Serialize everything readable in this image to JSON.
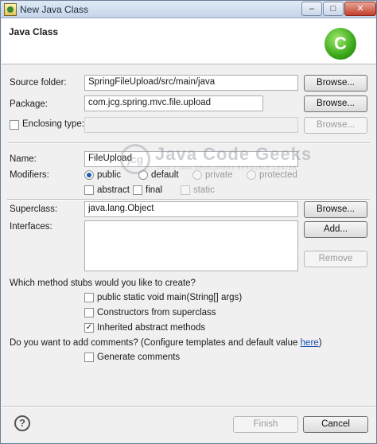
{
  "window": {
    "title": "New Java Class",
    "minimize": "–",
    "maximize": "□",
    "close": "✕"
  },
  "banner": {
    "title": "Java Class",
    "logo_letter": "C"
  },
  "form": {
    "source_folder": {
      "label": "Source folder:",
      "value": "SpringFileUpload/src/main/java",
      "browse": "Browse..."
    },
    "package": {
      "label": "Package:",
      "value": "com.jcg.spring.mvc.file.upload",
      "browse": "Browse..."
    },
    "enclosing_type": {
      "label": "Enclosing type:",
      "value": "",
      "browse": "Browse...",
      "checked": false
    },
    "name": {
      "label": "Name:",
      "value": "FileUpload"
    },
    "modifiers": {
      "label": "Modifiers:",
      "public": "public",
      "default": "default",
      "private": "private",
      "protected": "protected",
      "abstract": "abstract",
      "final": "final",
      "static": "static"
    },
    "superclass": {
      "label": "Superclass:",
      "value": "java.lang.Object",
      "browse": "Browse..."
    },
    "interfaces": {
      "label": "Interfaces:",
      "add": "Add...",
      "remove": "Remove"
    },
    "stubs": {
      "question": "Which method stubs would you like to create?",
      "main": "public static void main(String[] args)",
      "constructors": "Constructors from superclass",
      "inherited": "Inherited abstract methods"
    },
    "comments": {
      "question": "Do you want to add comments? (Configure templates and default value ",
      "link": "here",
      "suffix": ")",
      "generate": "Generate comments"
    }
  },
  "watermark": {
    "circle": "jcg",
    "text": "Java Code Geeks",
    "sub": "JAVA 2 JAVA DEVELOPERS RESOURCE CENTER"
  },
  "footer": {
    "help": "?",
    "finish": "Finish",
    "cancel": "Cancel"
  }
}
